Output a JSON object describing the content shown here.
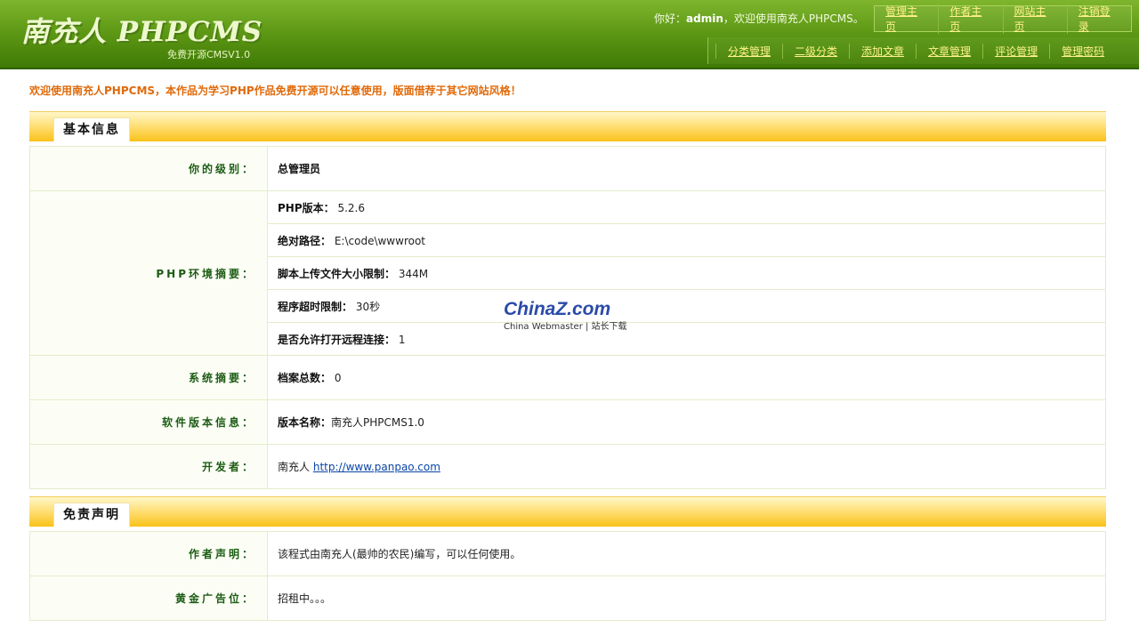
{
  "header": {
    "logo": "南充人 PHPCMS",
    "logo_sub": "免费开源CMSV1.0",
    "welcome_prefix": "你好：",
    "username": "admin",
    "welcome_suffix": "，欢迎使用南充人PHPCMS。",
    "top_links": [
      "管理主页",
      "作者主页",
      "网站主页",
      "注销登录"
    ],
    "nav_links": [
      "分类管理",
      "二级分类",
      "添加文章",
      "文章管理",
      "评论管理",
      "管理密码"
    ]
  },
  "notice": "欢迎使用南充人PHPCMS，本作品为学习PHP作品免费开源可以任意使用，版面借荐于其它网站风格！",
  "basic_info": {
    "title": "基本信息",
    "level_label": "你的级别：",
    "level_value": "总管理员",
    "php_label": "PHP环境摘要：",
    "php_rows": [
      {
        "key": "PHP版本：",
        "value": "5.2.6"
      },
      {
        "key": "绝对路径：",
        "value": "E:\\code\\wwwroot"
      },
      {
        "key": "脚本上传文件大小限制：",
        "value": "344M"
      },
      {
        "key": "程序超时限制：",
        "value": "30秒"
      },
      {
        "key": "是否允许打开远程连接：",
        "value": "1"
      }
    ],
    "system_label": "系统摘要：",
    "system_key": "档案总数：",
    "system_value": "0",
    "version_label": "软件版本信息：",
    "version_key": "版本名称：",
    "version_value": "南充人PHPCMS1.0",
    "dev_label": "开发者：",
    "dev_name": "南充人",
    "dev_link": "http://www.panpao.com"
  },
  "disclaimer": {
    "title": "免责声明",
    "author_label": "作者声明：",
    "author_value": "该程式由南充人(最帅的农民)编写，可以任何使用。",
    "ad_label": "黄金广告位：",
    "ad_value": "招租中。。。"
  },
  "watermark": {
    "main": "ChinaZ.com",
    "sub": "China Webmaster | 站长下载"
  }
}
